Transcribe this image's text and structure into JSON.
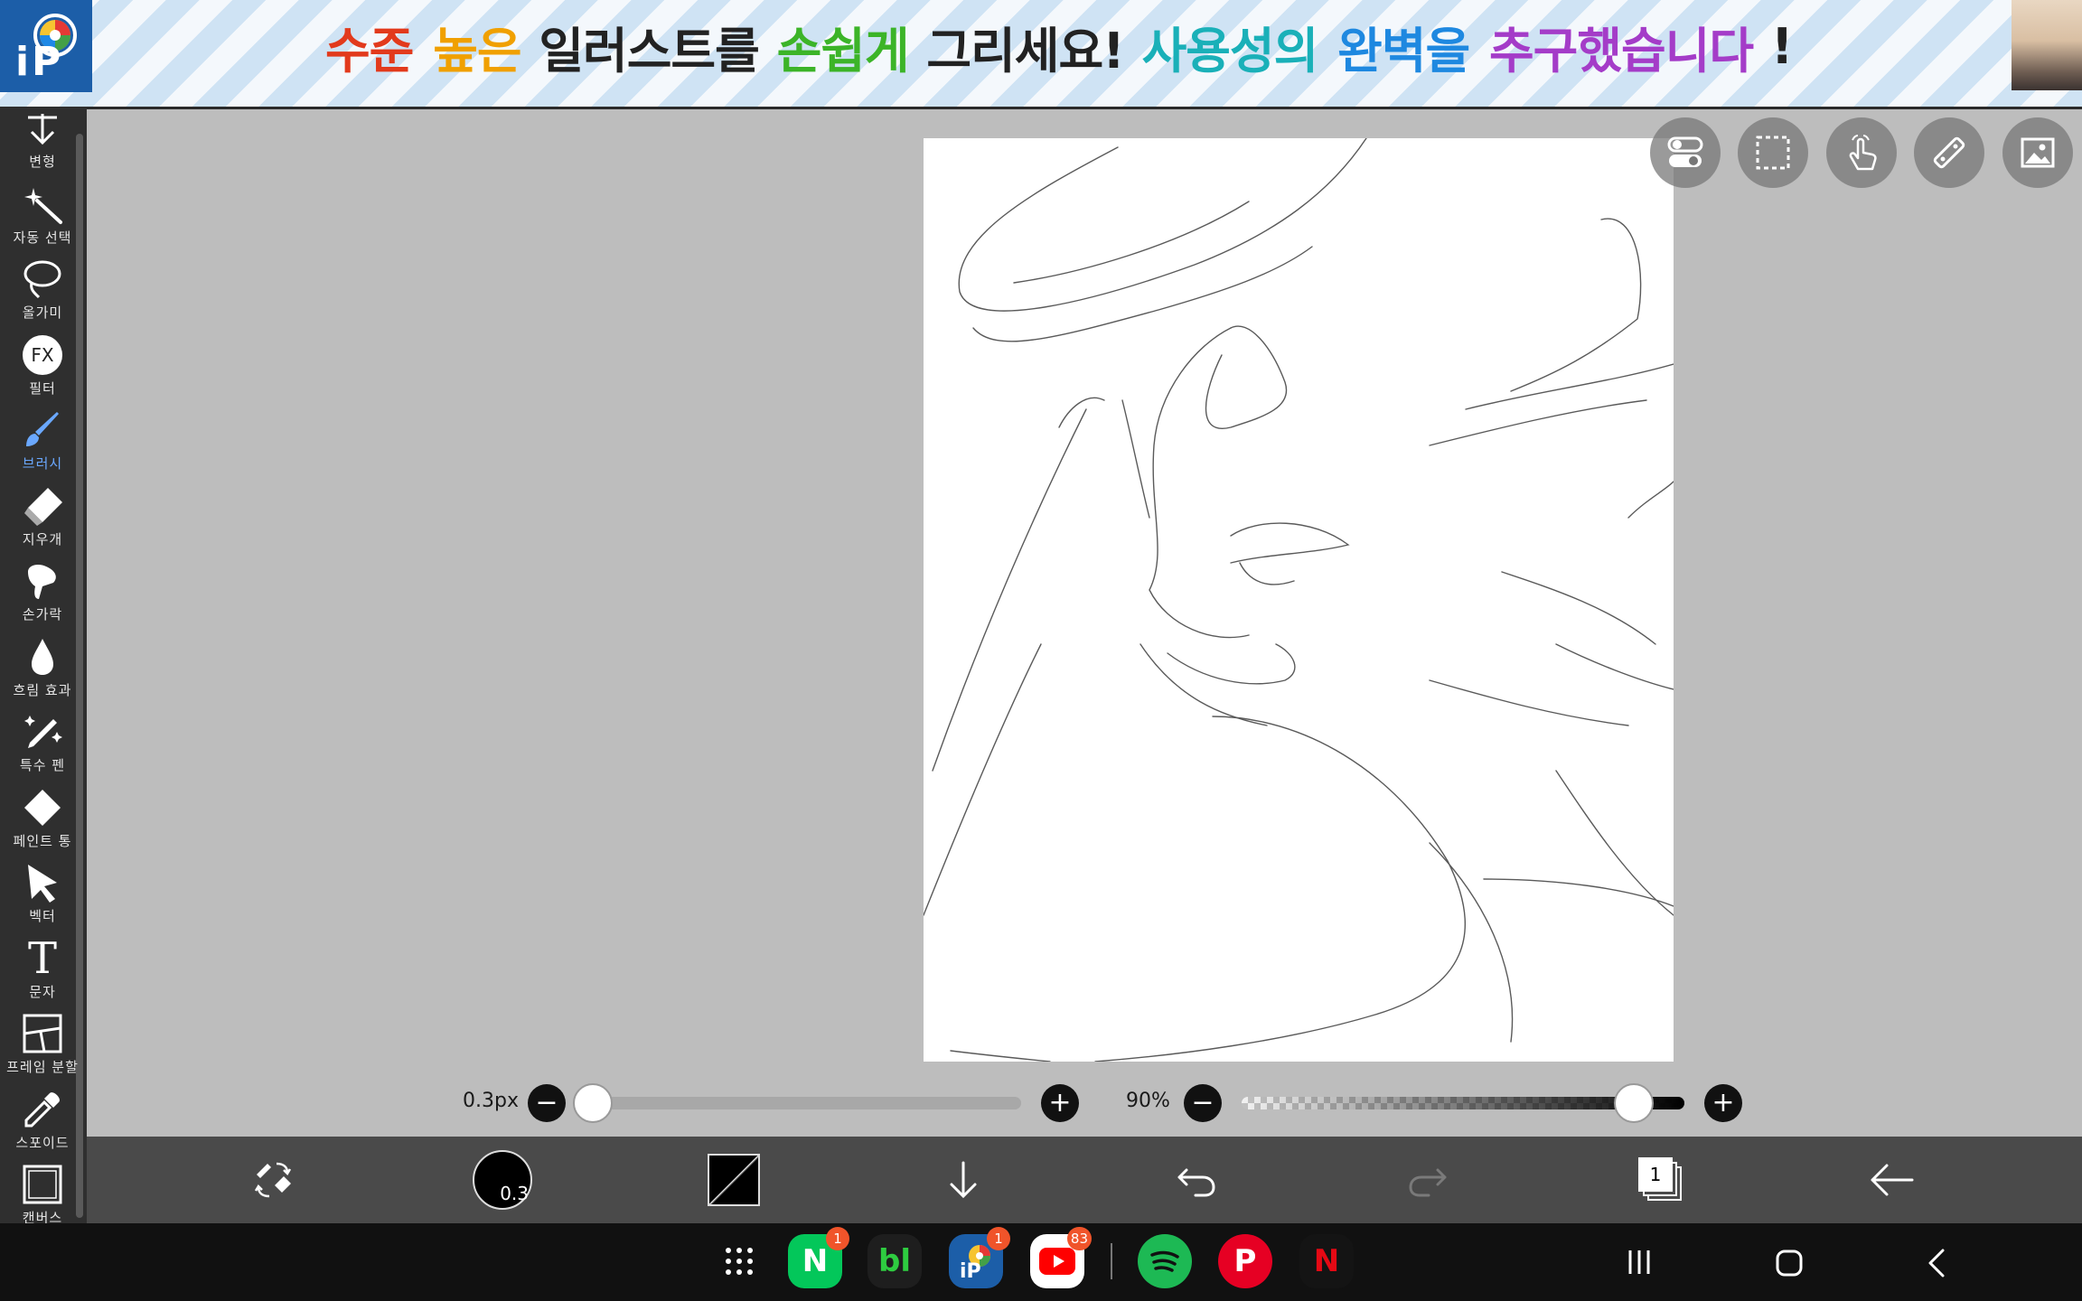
{
  "banner": {
    "segments": [
      {
        "text": "수준",
        "color": "#e23a1c"
      },
      {
        "text": " ",
        "color": "#222222"
      },
      {
        "text": "높은",
        "color": "#f0a000"
      },
      {
        "text": " 일러스트를 ",
        "color": "#222222"
      },
      {
        "text": "손쉽게",
        "color": "#3cb428"
      },
      {
        "text": " 그리세요! ",
        "color": "#222222"
      },
      {
        "text": "사용성의",
        "color": "#1ab0b8"
      },
      {
        "text": " ",
        "color": "#222222"
      },
      {
        "text": "완벽을",
        "color": "#1e88e0"
      },
      {
        "text": " ",
        "color": "#222222"
      },
      {
        "text": "추구했습니다",
        "color": "#a43cc8"
      },
      {
        "text": " !",
        "color": "#222222"
      }
    ]
  },
  "tools": [
    {
      "label": "변형",
      "icon": "transform-icon"
    },
    {
      "label": "자동 선택",
      "icon": "magic-wand-icon"
    },
    {
      "label": "올가미",
      "icon": "lasso-icon"
    },
    {
      "label": "필터",
      "icon": "fx-filter-icon",
      "glyph": "FX"
    },
    {
      "label": "브러시",
      "icon": "brush-icon",
      "active": true
    },
    {
      "label": "지우개",
      "icon": "eraser-icon"
    },
    {
      "label": "손가락",
      "icon": "finger-smudge-icon"
    },
    {
      "label": "흐림 효과",
      "icon": "blur-drop-icon"
    },
    {
      "label": "특수 펜",
      "icon": "special-pen-icon"
    },
    {
      "label": "페인트 통",
      "icon": "paint-bucket-icon"
    },
    {
      "label": "벡터",
      "icon": "vector-cursor-icon"
    },
    {
      "label": "문자",
      "icon": "text-icon",
      "glyph": "T"
    },
    {
      "label": "프레임 분할",
      "icon": "frame-divider-icon"
    },
    {
      "label": "스포이드",
      "icon": "eyedropper-icon"
    },
    {
      "label": "캔버스",
      "icon": "canvas-icon"
    }
  ],
  "sliders": {
    "brush_size": {
      "label": "0.3px",
      "fraction": 0.0
    },
    "opacity": {
      "label": "90%",
      "fraction": 0.9
    }
  },
  "bottom_toolbar": {
    "brush_size_badge": "0.3",
    "layer_count": "1",
    "primary_color": "#000000"
  },
  "dock": {
    "apps": [
      {
        "name": "naver",
        "glyph": "N",
        "badge": "1",
        "bg": "#03c75a"
      },
      {
        "name": "blog",
        "glyph": "bl",
        "badge": "",
        "bg": "#1e1e1e"
      },
      {
        "name": "ibispaint",
        "glyph": "",
        "badge": "1",
        "bg": "#1c5ea8"
      },
      {
        "name": "youtube",
        "glyph": "",
        "badge": "83",
        "bg": "#ffffff"
      },
      {
        "name": "spotify",
        "glyph": "",
        "badge": "",
        "bg": "#1db954"
      },
      {
        "name": "pinterest",
        "glyph": "P",
        "badge": "",
        "bg": "#e60023"
      },
      {
        "name": "netflix",
        "glyph": "N",
        "badge": "",
        "bg": "#141414"
      }
    ]
  }
}
